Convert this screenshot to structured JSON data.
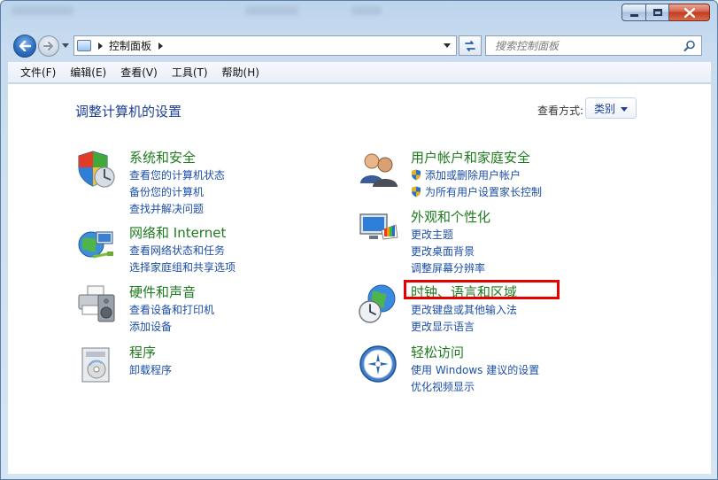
{
  "window": {
    "controls": {
      "minimize": "minimize",
      "maximize": "maximize",
      "close": "close"
    }
  },
  "address_bar": {
    "breadcrumb": "控制面板"
  },
  "search": {
    "placeholder": "搜索控制面板"
  },
  "menu": [
    {
      "label": "文件(F)"
    },
    {
      "label": "编辑(E)"
    },
    {
      "label": "查看(V)"
    },
    {
      "label": "工具(T)"
    },
    {
      "label": "帮助(H)"
    }
  ],
  "page": {
    "title": "调整计算机的设置",
    "view_label": "查看方式:",
    "view_value": "类别"
  },
  "categories": {
    "system": {
      "title": "系统和安全",
      "links": [
        "查看您的计算机状态",
        "备份您的计算机",
        "查找并解决问题"
      ]
    },
    "network": {
      "title": "网络和 Internet",
      "links": [
        "查看网络状态和任务",
        "选择家庭组和共享选项"
      ]
    },
    "hardware": {
      "title": "硬件和声音",
      "links": [
        "查看设备和打印机",
        "添加设备"
      ]
    },
    "programs": {
      "title": "程序",
      "links": [
        "卸载程序"
      ]
    },
    "users": {
      "title": "用户帐户和家庭安全",
      "links": [
        "添加或删除用户帐户",
        "为所有用户设置家长控制"
      ]
    },
    "appearance": {
      "title": "外观和个性化",
      "links": [
        "更改主题",
        "更改桌面背景",
        "调整屏幕分辨率"
      ]
    },
    "clock": {
      "title": "时钟、语言和区域",
      "links": [
        "更改键盘或其他输入法",
        "更改显示语言"
      ]
    },
    "ease": {
      "title": "轻松访问",
      "links": [
        "使用 Windows 建议的设置",
        "优化视频显示"
      ]
    }
  },
  "colors": {
    "category_title": "#1e7b1e",
    "link": "#1c4fa8",
    "page_title": "#1c3f94",
    "highlight": "#e50000"
  }
}
